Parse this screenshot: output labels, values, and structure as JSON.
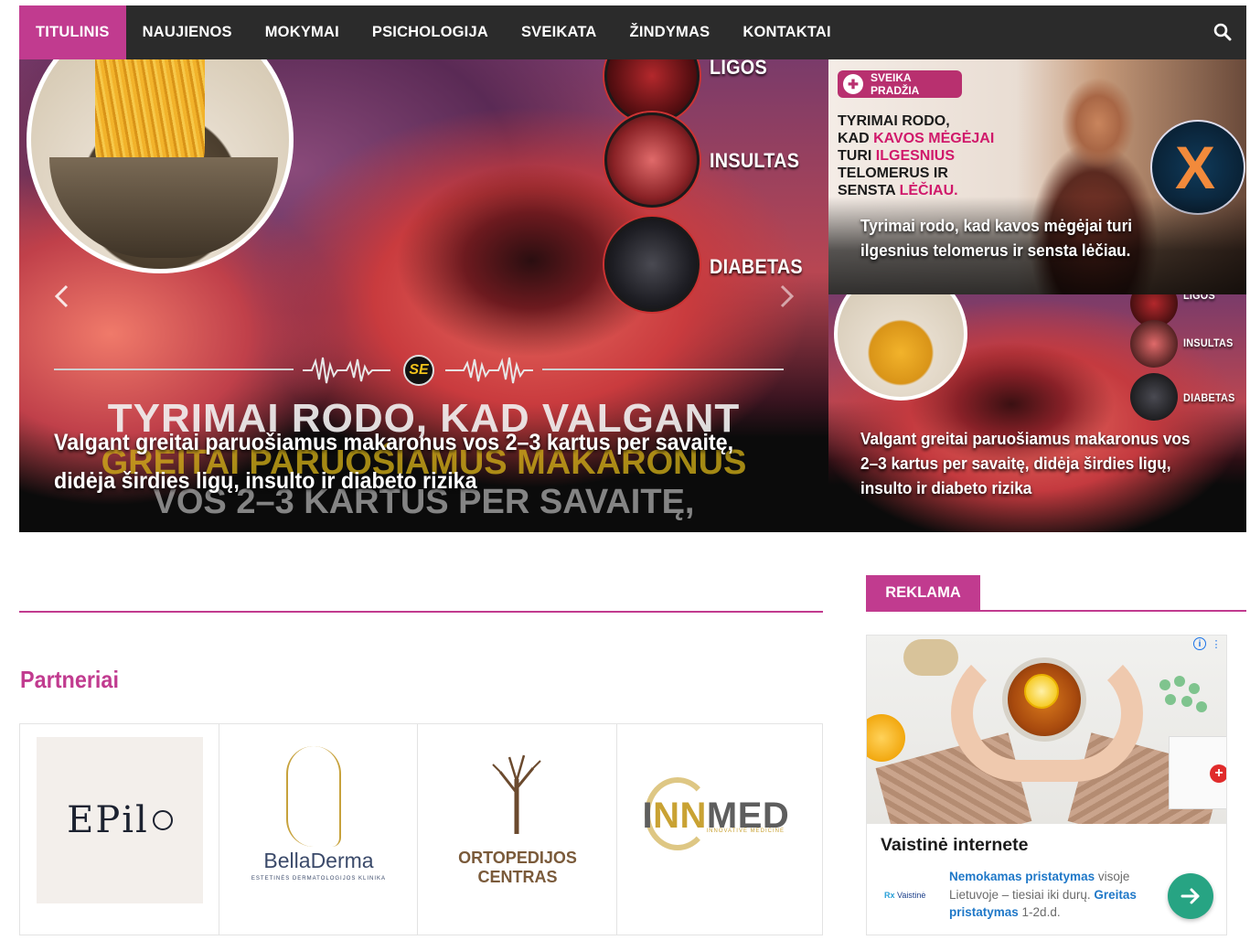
{
  "nav": {
    "items": [
      {
        "label": "TITULINIS",
        "active": true
      },
      {
        "label": "NAUJIENOS"
      },
      {
        "label": "MOKYMAI"
      },
      {
        "label": "PSICHOLOGIJA"
      },
      {
        "label": "SVEIKATA"
      },
      {
        "label": "ŽINDYMAS"
      },
      {
        "label": "KONTAKTAI"
      }
    ],
    "search_icon": "search-icon"
  },
  "hero": {
    "main": {
      "title": "Valgant greitai paruošiamus makaronus vos 2–3 kartus per savaitę, didėja širdies ligų, insulto ir diabeto rizika",
      "image_labels": [
        "LIGOS",
        "INSULTAS",
        "DIABETAS"
      ],
      "image_badge": "SE",
      "image_lines": [
        "TYRIMAI RODO, KAD VALGANT",
        "GREITAI PARUOŠIAMUS MAKARONUS",
        "VOS 2–3 KARTUS PER SAVAITĘ,"
      ],
      "prev_icon": "chevron-left-icon",
      "next_icon": "chevron-right-icon"
    },
    "side": [
      {
        "title": "Tyrimai rodo, kad kavos mėgėjai turi ilgesnius telomerus ir sensta lėčiau.",
        "image_logo": "SVEIKA PRADŽIA",
        "image_text_1": "TYRIMAI RODO,",
        "image_text_2a": "KAD ",
        "image_text_2b": "KAVOS MĖGĖJAI",
        "image_text_3a": "TURI ",
        "image_text_3b": "ILGESNIUS",
        "image_text_4": "TELOMERUS IR",
        "image_text_5a": "SENSTA ",
        "image_text_5b": "LĖČIAU."
      },
      {
        "title": "Valgant greitai paruošiamus makaronus vos 2–3 kartus per savaitę, didėja širdies ligų, insulto ir diabeto rizika",
        "image_labels": [
          "LIGOS",
          "INSULTAS",
          "DIABETAS"
        ]
      }
    ]
  },
  "partners": {
    "title": "Partneriai",
    "items": [
      {
        "name": "EPil",
        "logo_text": "EPil"
      },
      {
        "name": "BellaDerma",
        "logo_text": "BellaDerma",
        "sub": "ESTETINĖS DERMATOLOGIJOS KLINIKA"
      },
      {
        "name": "Ortopedijos Centras",
        "line1": "ORTOPEDIJOS",
        "line2": "CENTRAS"
      },
      {
        "name": "INNMED",
        "part_a": "I",
        "part_b": "NN",
        "part_c": "MED",
        "sub": "INNOVATIVE MEDICINE"
      }
    ]
  },
  "sidebar": {
    "tab": "REKLAMA",
    "ad": {
      "headline": "Vaistinė internete",
      "logo_prefix": "Rx ",
      "logo": "Vaistinė",
      "desc_hl1": "Nemokamas pristatymas",
      "desc_mid": " visoje Lietuvoje – tiesiai iki durų. ",
      "desc_hl2": "Greitas pristatymas",
      "desc_end": " 1-2d.d.",
      "cta_icon": "arrow-right-icon",
      "info_icon": "info-icon",
      "menu_icon": "kebab-menu-icon"
    }
  },
  "colors": {
    "accent": "#c13b8f",
    "nav_bg": "#2b2b2b",
    "cta": "#27a483"
  }
}
